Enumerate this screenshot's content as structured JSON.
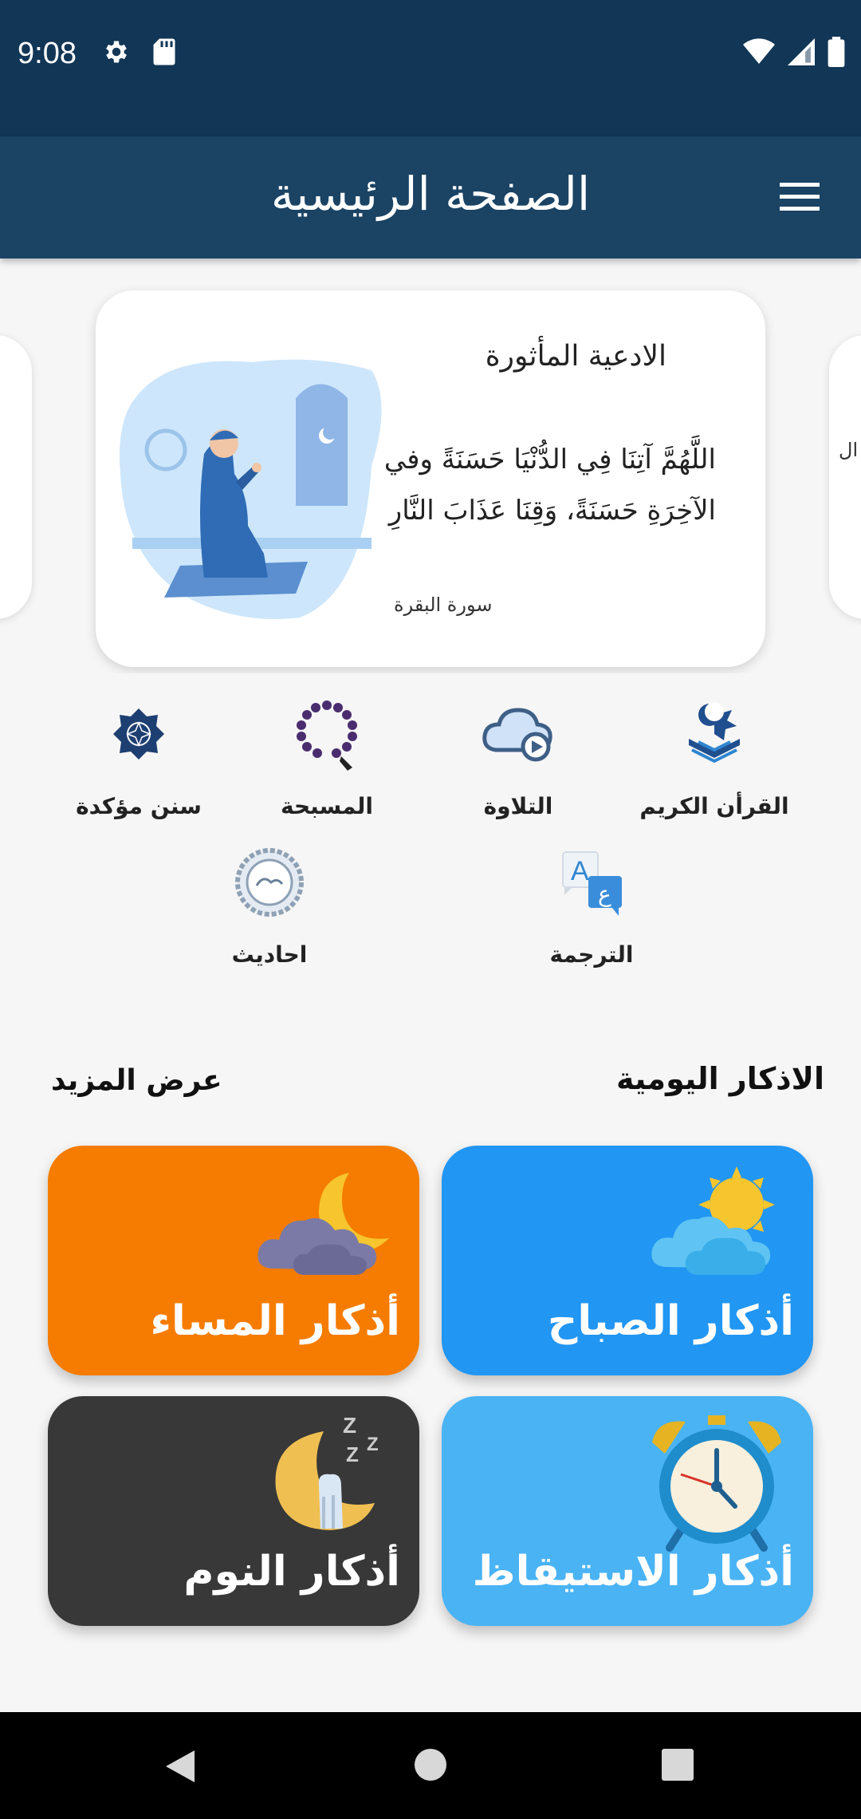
{
  "status_bar": {
    "time": "9:08"
  },
  "app_bar": {
    "title": "الصفحة الرئيسية"
  },
  "carousel": {
    "peek_left_text": "ال",
    "card": {
      "title": "الادعية المأثورة",
      "dua": "اللَّهُمَّ آتِنَا فِي الدُّنْيَا حَسَنَةً وفي الآخِرَةِ حَسَنَةً، وَقِنَا عَذَابَ النَّارِ",
      "source": "سورة البقرة"
    }
  },
  "features": [
    {
      "label": "القرأن الكريم",
      "icon": "quran-icon"
    },
    {
      "label": "التلاوة",
      "icon": "cloud-play-icon"
    },
    {
      "label": "المسبحة",
      "icon": "prayer-beads-icon"
    },
    {
      "label": "سنن مؤكدة",
      "icon": "star-emblem-icon"
    },
    {
      "label": "الترجمة",
      "icon": "translate-icon"
    },
    {
      "label": "احاديث",
      "icon": "hadith-seal-icon"
    }
  ],
  "daily_adhkar": {
    "title": "الاذكار اليومية",
    "more": "عرض المزيد",
    "tiles": [
      {
        "label": "أذكار الصباح",
        "color": "#2196f3",
        "icon": "sun-cloud-icon"
      },
      {
        "label": "أذكار المساء",
        "color": "#f57c00",
        "icon": "moon-cloud-icon"
      },
      {
        "label": "أذكار الاستيقاظ",
        "color": "#4ab3f4",
        "icon": "alarm-clock-icon"
      },
      {
        "label": "أذكار النوم",
        "color": "#383838",
        "icon": "sleep-moon-icon"
      }
    ]
  }
}
